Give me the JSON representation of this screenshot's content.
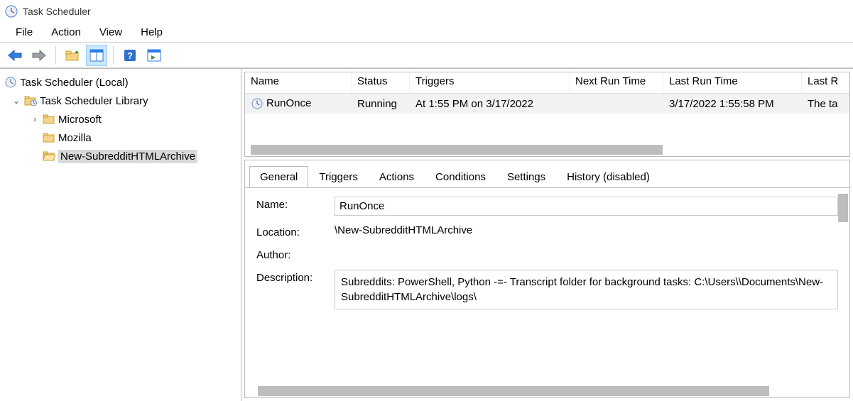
{
  "window": {
    "title": "Task Scheduler"
  },
  "menu": {
    "file": "File",
    "action": "Action",
    "view": "View",
    "help": "Help"
  },
  "tree": {
    "root": "Task Scheduler (Local)",
    "library": "Task Scheduler Library",
    "items": [
      "Microsoft",
      "Mozilla",
      "New-SubredditHTMLArchive"
    ]
  },
  "list": {
    "headers": [
      "Name",
      "Status",
      "Triggers",
      "Next Run Time",
      "Last Run Time",
      "Last R"
    ],
    "row": {
      "name": "RunOnce",
      "status": "Running",
      "triggers": "At 1:55 PM on 3/17/2022",
      "next_run": "",
      "last_run": "3/17/2022 1:55:58 PM",
      "last_result": "The ta"
    }
  },
  "tabs": [
    "General",
    "Triggers",
    "Actions",
    "Conditions",
    "Settings",
    "History (disabled)"
  ],
  "general": {
    "name_label": "Name:",
    "name_value": "RunOnce",
    "location_label": "Location:",
    "location_value": "\\New-SubredditHTMLArchive",
    "author_label": "Author:",
    "author_value": "",
    "description_label": "Description:",
    "description_value": "Subreddits: PowerShell, Python    -=-    Transcript folder for background tasks: C:\\Users\\\\Documents\\New-SubredditHTMLArchive\\logs\\"
  }
}
